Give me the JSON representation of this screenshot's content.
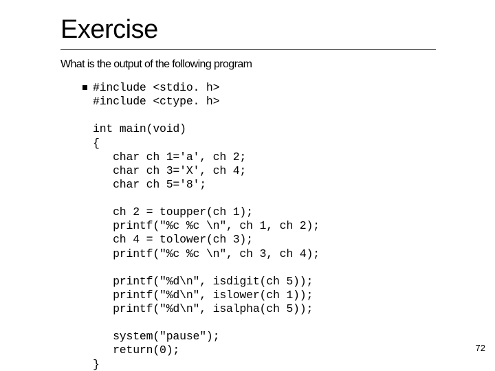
{
  "title": "Exercise",
  "subtitle": "What is the output of the following program",
  "code": "#include <stdio. h>\n#include <ctype. h>\n\nint main(void)\n{\n   char ch 1='a', ch 2;\n   char ch 3='X', ch 4;\n   char ch 5='8';\n\n   ch 2 = toupper(ch 1);\n   printf(\"%c %c \\n\", ch 1, ch 2);\n   ch 4 = tolower(ch 3);\n   printf(\"%c %c \\n\", ch 3, ch 4);\n\n   printf(\"%d\\n\", isdigit(ch 5));\n   printf(\"%d\\n\", islower(ch 1));\n   printf(\"%d\\n\", isalpha(ch 5));\n\n   system(\"pause\");\n   return(0);\n}",
  "page_number": "72"
}
